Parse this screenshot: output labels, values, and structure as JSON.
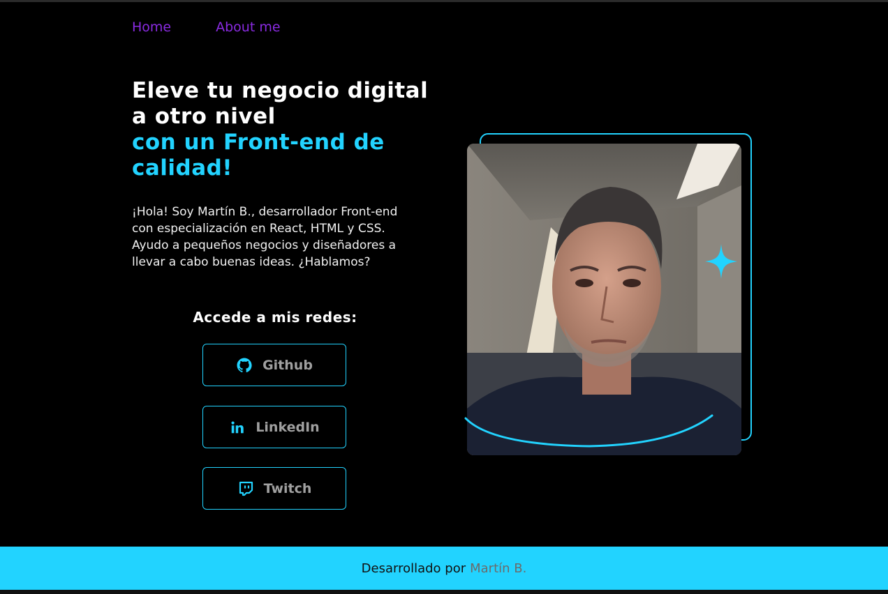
{
  "nav": {
    "home": "Home",
    "about": "About me"
  },
  "hero": {
    "headline_white": "Eleve tu negocio digital a otro nivel",
    "headline_cyan": "con un Front-end de calidad!",
    "intro": "¡Hola! Soy Martín B., desarrollador Front-end con especialización en React, HTML y CSS. Ayudo a pequeños negocios y diseñadores a llevar a cabo buenas ideas. ¿Hablamos?"
  },
  "social": {
    "title": "Accede a mis redes:",
    "buttons": [
      {
        "label": "Github",
        "icon": "github-icon"
      },
      {
        "label": "LinkedIn",
        "icon": "linkedin-icon"
      },
      {
        "label": "Twitch",
        "icon": "twitch-icon"
      }
    ]
  },
  "footer": {
    "text": "Desarrollado por",
    "author": "Martín B."
  },
  "colors": {
    "accent_cyan": "#22d3ff",
    "nav_purple": "#8a2be2",
    "background": "#000000"
  }
}
